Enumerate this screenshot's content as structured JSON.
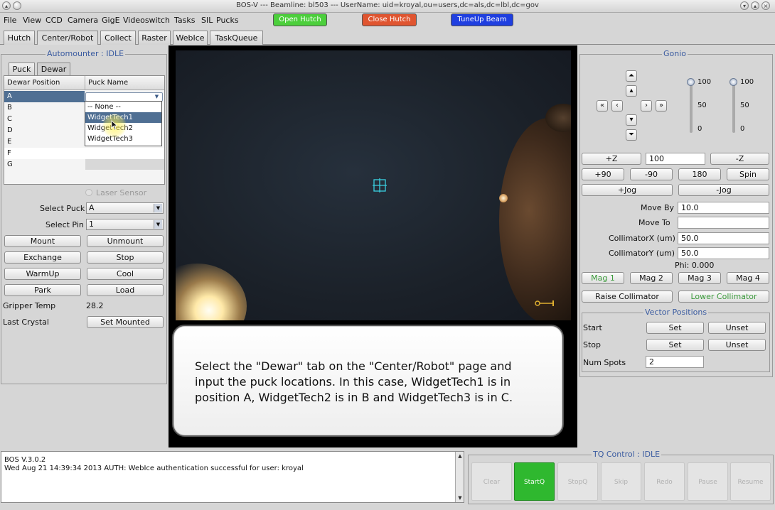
{
  "window": {
    "title": "BOS-V     --- Beamline: bl503 --- UserName: uid=kroyal,ou=users,dc=als,dc=lbl,dc=gov"
  },
  "menu": [
    "File",
    "View",
    "CCD",
    "Camera",
    "GigE",
    "Videoswitch",
    "Tasks",
    "SIL",
    "Pucks"
  ],
  "top_buttons": {
    "open_hutch": "Open Hutch",
    "close_hutch": "Close Hutch",
    "tuneup_beam": "TuneUp Beam"
  },
  "tabs": [
    "Hutch",
    "Center/Robot",
    "Collect",
    "Raster",
    "WebIce",
    "TaskQueue"
  ],
  "automounter": {
    "title": "Automounter : IDLE",
    "subtabs": [
      "Puck",
      "Dewar"
    ],
    "table_headers": [
      "Dewar Position",
      "Puck Name"
    ],
    "positions": [
      "A",
      "B",
      "C",
      "D",
      "E",
      "F",
      "G"
    ],
    "dropdown_options": [
      "-- None --",
      "WidgetTech1",
      "WidgetTech2",
      "WidgetTech3"
    ],
    "laser_sensor": "Laser Sensor",
    "select_puck_label": "Select Puck",
    "select_puck_value": "A",
    "select_pin_label": "Select Pin",
    "select_pin_value": "1",
    "buttons": [
      "Mount",
      "Unmount",
      "Exchange",
      "Stop",
      "WarmUp",
      "Cool",
      "Park",
      "Load"
    ],
    "gripper_temp_label": "Gripper Temp",
    "gripper_temp_value": "28.2",
    "last_crystal_label": "Last Crystal",
    "set_mounted": "Set Mounted"
  },
  "callout": {
    "text": "Select the \"Dewar\" tab on the \"Center/Robot\" page and input the puck locations. In this case, WidgetTech1 is in position A, WidgetTech2 is in B and WidgetTech3 is in C."
  },
  "gonio": {
    "title": "Gonio",
    "slider1": [
      "100",
      "50",
      "0"
    ],
    "slider2": [
      "100",
      "50",
      "0"
    ],
    "plus_z": "+Z",
    "z_value": "100",
    "minus_z": "-Z",
    "rot_buttons": [
      "+90",
      "-90",
      "180",
      "Spin"
    ],
    "plus_jog": "+Jog",
    "minus_jog": "-Jog",
    "move_by_label": "Move By",
    "move_by_value": "10.0",
    "move_to_label": "Move To",
    "move_to_value": "",
    "collx_label": "CollimatorX (um)",
    "collx_value": "50.0",
    "colly_label": "CollimatorY (um)",
    "colly_value": "50.0",
    "phi": "Phi: 0.000",
    "mag_buttons": [
      "Mag 1",
      "Mag 2",
      "Mag 3",
      "Mag 4"
    ],
    "raise_collimator": "Raise Collimator",
    "lower_collimator": "Lower Collimator"
  },
  "vector": {
    "title": "Vector Positions",
    "start_label": "Start",
    "stop_label": "Stop",
    "set": "Set",
    "unset": "Unset",
    "num_spots_label": "Num Spots",
    "num_spots_value": "2"
  },
  "log": {
    "line1": "BOS V.3.0.2",
    "line2": "Wed Aug 21 14:39:34 2013 AUTH: WebIce authentication successful for user: kroyal"
  },
  "tq": {
    "title": "TQ Control : IDLE",
    "buttons": [
      "Clear",
      "StartQ",
      "StopQ",
      "Skip",
      "Redo",
      "Pause",
      "Resume"
    ]
  },
  "colors": {
    "open_hutch": "#4ccf3c",
    "close_hutch": "#e05530",
    "tuneup_beam": "#1f3fe0",
    "panel_label": "#3a5ba0",
    "startq": "#2fb82f",
    "selection": "#4f6f93"
  }
}
